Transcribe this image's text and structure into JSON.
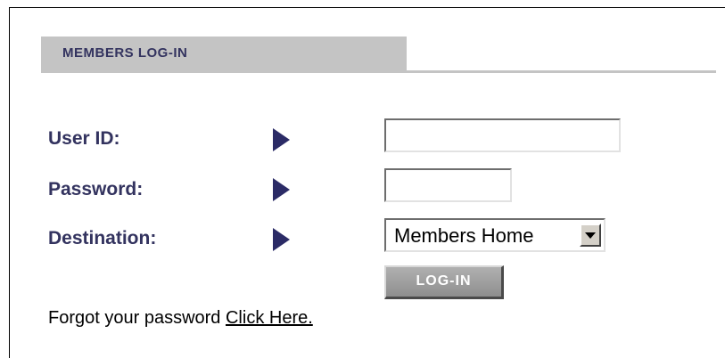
{
  "header": {
    "title": "MEMBERS LOG-IN"
  },
  "form": {
    "user_id_label": "User ID:",
    "user_id_value": "",
    "password_label": "Password:",
    "password_value": "",
    "destination_label": "Destination:",
    "destination_selected": "Members Home",
    "login_button_label": "LOG-IN"
  },
  "footer": {
    "forgot_text": "Forgot your password",
    "click_here_label": "Click Here."
  },
  "icons": {
    "field_arrow": "right-triangle-arrow-icon",
    "dropdown": "chevron-down-icon"
  },
  "colors": {
    "label_navy": "#33335f",
    "arrow_navy": "#2b2b66",
    "header_gray": "#c4c4c4",
    "button_gray": "#9e9e9e"
  }
}
